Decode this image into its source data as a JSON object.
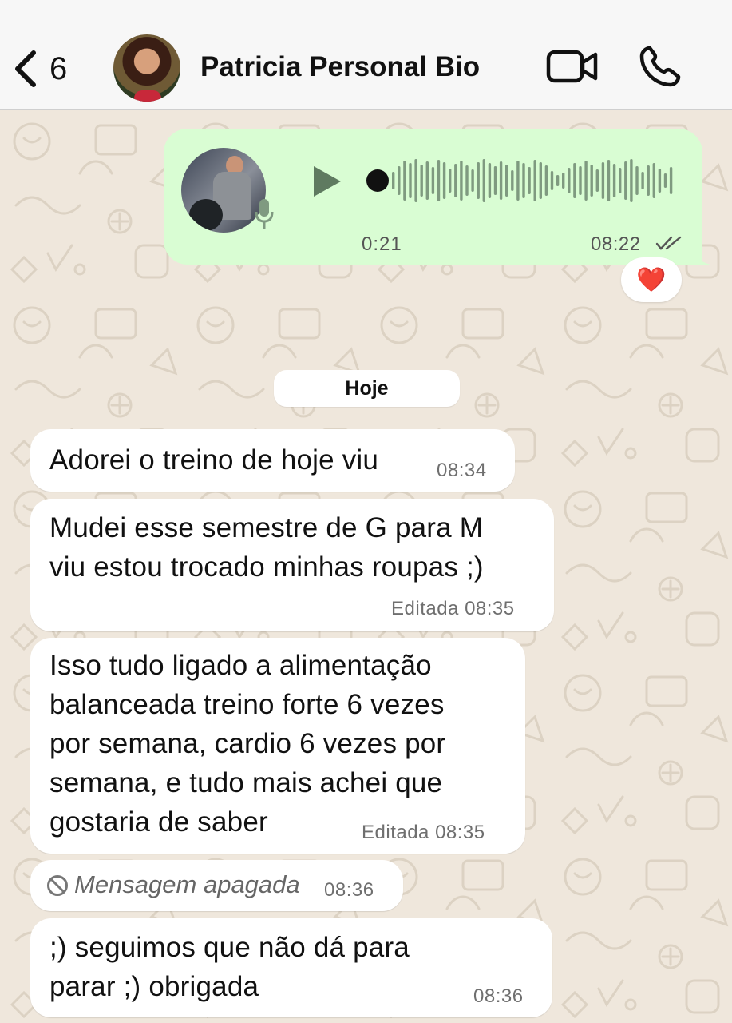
{
  "header": {
    "back_count": "6",
    "contact_name": "Patricia Personal Bio",
    "avatar_icon": "contact-avatar",
    "video_icon": "video-camera-icon",
    "call_icon": "phone-icon"
  },
  "voice_message": {
    "duration": "0:21",
    "time": "08:22",
    "status": "read",
    "reaction": "❤️"
  },
  "date_divider": "Hoje",
  "messages": [
    {
      "lines": [
        "Adorei o treino de hoje viu"
      ],
      "meta": "08:34"
    },
    {
      "lines": [
        "Mudei esse semestre de G para M",
        "viu estou trocado minhas roupas ;)"
      ],
      "meta": "Editada 08:35"
    },
    {
      "lines": [
        "Isso tudo ligado a alimentação",
        "balanceada  treino forte 6 vezes",
        "por semana, cardio 6 vezes por",
        "semana, e tudo mais achei que",
        "gostaria de saber"
      ],
      "meta": "Editada 08:35"
    },
    {
      "deleted_text": "Mensagem apagada",
      "meta": "08:36"
    },
    {
      "lines": [
        ";) seguimos que não dá para",
        "parar ;) obrigada"
      ],
      "meta": "08:36"
    }
  ],
  "colors": {
    "outgoing_bubble": "#d9fdd3",
    "incoming_bubble": "#ffffff",
    "chat_background": "#efe7dc",
    "header_background": "#f7f7f7",
    "waveform": "#7f9a80"
  }
}
